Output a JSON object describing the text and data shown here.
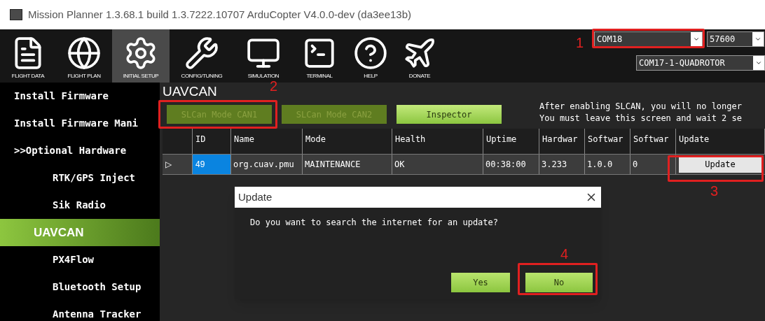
{
  "window": {
    "title": "Mission Planner 1.3.68.1 build 1.3.7222.10707 ArduCopter V4.0.0-dev (da3ee13b)"
  },
  "toolbar": {
    "items": [
      {
        "label": "FLIGHT DATA",
        "kind": "data",
        "selected": false
      },
      {
        "label": "FLIGHT PLAN",
        "kind": "plan",
        "selected": false
      },
      {
        "label": "INITIAL SETUP",
        "kind": "setup",
        "selected": true
      },
      {
        "label": "CONFIG/TUNING",
        "kind": "config",
        "selected": false
      },
      {
        "label": "SIMULATION",
        "kind": "sim",
        "selected": false
      },
      {
        "label": "TERMINAL",
        "kind": "terminal",
        "selected": false
      },
      {
        "label": "HELP",
        "kind": "help",
        "selected": false
      },
      {
        "label": "DONATE",
        "kind": "donate",
        "selected": false
      }
    ]
  },
  "connection": {
    "port": "COM18",
    "baud": "57600",
    "link": "COM17-1-QUADROTOR"
  },
  "sidebar": {
    "items": [
      {
        "label": "Install Firmware",
        "selected": false
      },
      {
        "label": "Install Firmware Mani",
        "selected": false
      },
      {
        "label": ">>Optional Hardware",
        "selected": false,
        "children": [
          {
            "label": "RTK/GPS Inject",
            "selected": false
          },
          {
            "label": "Sik Radio",
            "selected": false
          },
          {
            "label": "UAVCAN",
            "selected": true
          },
          {
            "label": "PX4Flow",
            "selected": false
          },
          {
            "label": "Bluetooth Setup",
            "selected": false
          },
          {
            "label": "Antenna Tracker",
            "selected": false
          }
        ]
      }
    ]
  },
  "page": {
    "title": "UAVCAN",
    "buttons": [
      {
        "label": "SLCan Mode CAN1",
        "disabled": true
      },
      {
        "label": "SLCan Mode CAN2",
        "disabled": true
      },
      {
        "label": "Inspector",
        "disabled": false
      }
    ],
    "notice": [
      "After enabling SLCAN, you will no longer",
      "You must leave this screen and wait 2 se"
    ]
  },
  "table": {
    "columns": [
      "",
      "ID",
      "Name",
      "Mode",
      "Health",
      "Uptime",
      "Hardwar",
      "Softwar",
      "Softwar",
      "Update"
    ],
    "rows": [
      {
        "marker": "▷",
        "id": {
          "text": "49",
          "selected": true
        },
        "values": [
          "org.cuav.pmu",
          "MAINTENANCE",
          "OK",
          "00:38:00",
          "3.233",
          "1.0.0",
          "0"
        ],
        "action": "Update"
      }
    ]
  },
  "dialog": {
    "title": "Update",
    "message": "Do you want to search the internet for an update?",
    "buttons": [
      "Yes",
      "No"
    ]
  },
  "annotations": [
    {
      "number": "1"
    },
    {
      "number": "2"
    },
    {
      "number": "3"
    },
    {
      "number": "4"
    }
  ]
}
